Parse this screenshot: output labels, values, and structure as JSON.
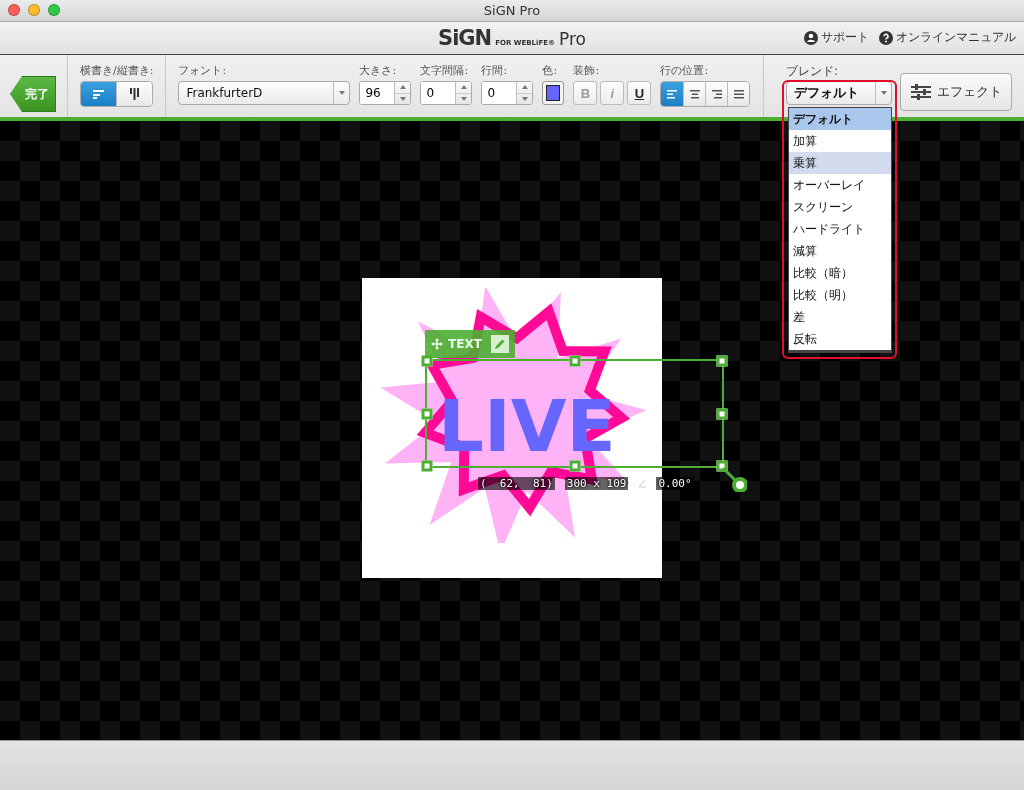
{
  "window": {
    "title": "SiGN Pro"
  },
  "header": {
    "logo": {
      "name": "SiGN",
      "subtitle": "FOR WEBLiFE®",
      "edition": "Pro"
    },
    "links": [
      {
        "kind": "support",
        "label": "サポート"
      },
      {
        "kind": "help",
        "label": "オンラインマニュアル"
      }
    ]
  },
  "toolbar": {
    "done_button": "完了",
    "orientation": {
      "label": "横書き/縦書き:",
      "options": [
        {
          "kind": "horizontal",
          "selected": true
        },
        {
          "kind": "vertical",
          "selected": false
        }
      ]
    },
    "font": {
      "label": "フォント:",
      "value": "FrankfurterD"
    },
    "size": {
      "label": "大きさ:",
      "value": "96"
    },
    "letter_spacing": {
      "label": "文字間隔:",
      "value": "0"
    },
    "line_spacing": {
      "label": "行間:",
      "value": "0"
    },
    "color": {
      "label": "色:",
      "color": "#6666ff"
    },
    "decoration": {
      "label": "装飾:",
      "buttons": [
        {
          "kind": "bold",
          "text": "B",
          "disabled": true
        },
        {
          "kind": "italic",
          "text": "i",
          "disabled": true
        },
        {
          "kind": "underline",
          "text": "U",
          "disabled": false
        }
      ]
    },
    "alignment": {
      "label": "行の位置:",
      "options": [
        {
          "kind": "left",
          "selected": true
        },
        {
          "kind": "center",
          "selected": false
        },
        {
          "kind": "right",
          "selected": false
        },
        {
          "kind": "justify",
          "selected": false
        }
      ]
    },
    "blend": {
      "label": "ブレンド:",
      "value": "デフォルト",
      "expanded": true,
      "options": [
        {
          "label": "デフォルト",
          "selected": true,
          "hovered": false
        },
        {
          "label": "加算",
          "selected": false,
          "hovered": false
        },
        {
          "label": "乗算",
          "selected": false,
          "hovered": true
        },
        {
          "label": "オーバーレイ",
          "selected": false,
          "hovered": false
        },
        {
          "label": "スクリーン",
          "selected": false,
          "hovered": false
        },
        {
          "label": "ハードライト",
          "selected": false,
          "hovered": false
        },
        {
          "label": "減算",
          "selected": false,
          "hovered": false
        },
        {
          "label": "比較（暗）",
          "selected": false,
          "hovered": false
        },
        {
          "label": "比較（明）",
          "selected": false,
          "hovered": false
        },
        {
          "label": "差",
          "selected": false,
          "hovered": false
        },
        {
          "label": "反転",
          "selected": false,
          "hovered": false
        }
      ]
    },
    "effect_button": "エフェクト"
  },
  "canvas": {
    "artwork_text": "LIVE",
    "selection": {
      "badge": "TEXT",
      "position": "(  62,  81)",
      "size": "300 x 109",
      "angle": "0.00°"
    }
  }
}
